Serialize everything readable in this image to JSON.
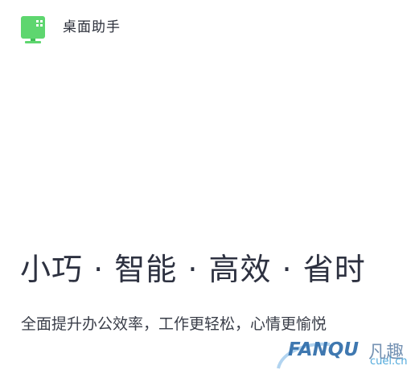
{
  "header": {
    "app_icon": "desktop-monitor-icon",
    "title": "桌面助手"
  },
  "hero": {
    "headline": "小巧 · 智能 · 高效 · 省时",
    "subline": "全面提升办公效率，工作更轻松，心情更愉悦"
  },
  "watermark": {
    "brand": "FANQU",
    "cn": "凡趣",
    "domain": "cuel.cn"
  },
  "colors": {
    "icon_green": "#5ed66f",
    "icon_green_dark": "#3fbf55",
    "text_dark": "#2d3140",
    "watermark_blue": "#2b6aa8"
  }
}
